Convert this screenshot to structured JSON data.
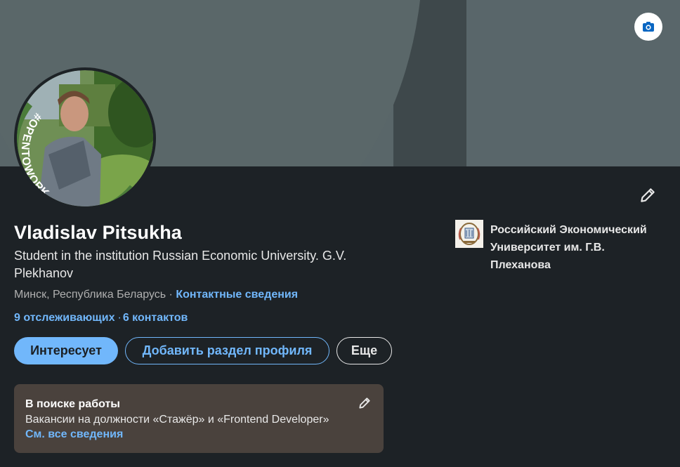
{
  "cover": {
    "camera_icon": "camera-icon"
  },
  "avatar": {
    "badge_text": "#OPENTOWORK",
    "badge_color": "#4b7c3a"
  },
  "profile": {
    "name": "Vladislav Pitsukha",
    "headline": "Student in the institution Russian Economic University. G.V. Plekhanov",
    "location": "Минск, Республика Беларусь",
    "location_separator": " · ",
    "contact_info_link": "Контактные сведения",
    "followers": "9 отслеживающих",
    "connections": "6 контактов"
  },
  "actions": {
    "open_to": "Интересует",
    "add_section": "Добавить раздел профиля",
    "more": "Еще"
  },
  "open_to_work": {
    "title": "В поиске работы",
    "description": "Вакансии на должности «Стажёр» и «Frontend Developer»",
    "see_all": "См. все сведения"
  },
  "education": {
    "school": "Российский Экономический Университет им. Г.В. Плеханова"
  },
  "colors": {
    "accent": "#71b7fb",
    "background": "#1d2226",
    "otw_box": "#4a423d"
  }
}
